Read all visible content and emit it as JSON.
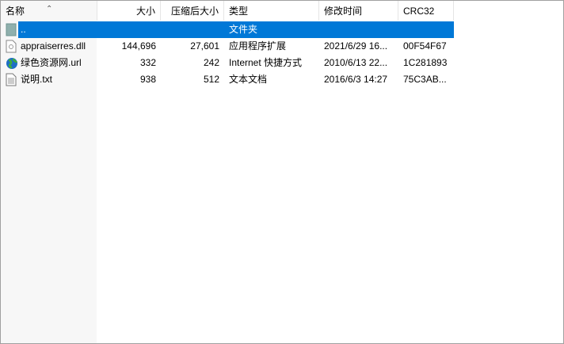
{
  "columns": {
    "name": "名称",
    "size": "大小",
    "packed": "压缩后大小",
    "type": "类型",
    "modified": "修改时间",
    "crc": "CRC32"
  },
  "rows": [
    {
      "name": "..",
      "size": "",
      "packed": "",
      "type": "文件夹",
      "modified": "",
      "crc": "",
      "icon": "folder-up-icon",
      "selected": true
    },
    {
      "name": "appraiserres.dll",
      "size": "144,696",
      "packed": "27,601",
      "type": "应用程序扩展",
      "modified": "2021/6/29 16...",
      "crc": "00F54F67",
      "icon": "dll-file-icon"
    },
    {
      "name": "绿色资源网.url",
      "size": "332",
      "packed": "242",
      "type": "Internet 快捷方式",
      "modified": "2010/6/13 22...",
      "crc": "1C281893",
      "icon": "globe-url-icon"
    },
    {
      "name": "说明.txt",
      "size": "938",
      "packed": "512",
      "type": "文本文档",
      "modified": "2016/6/3 14:27",
      "crc": "75C3AB...",
      "icon": "text-file-icon"
    }
  ],
  "colors": {
    "selection": "#0078d7"
  }
}
